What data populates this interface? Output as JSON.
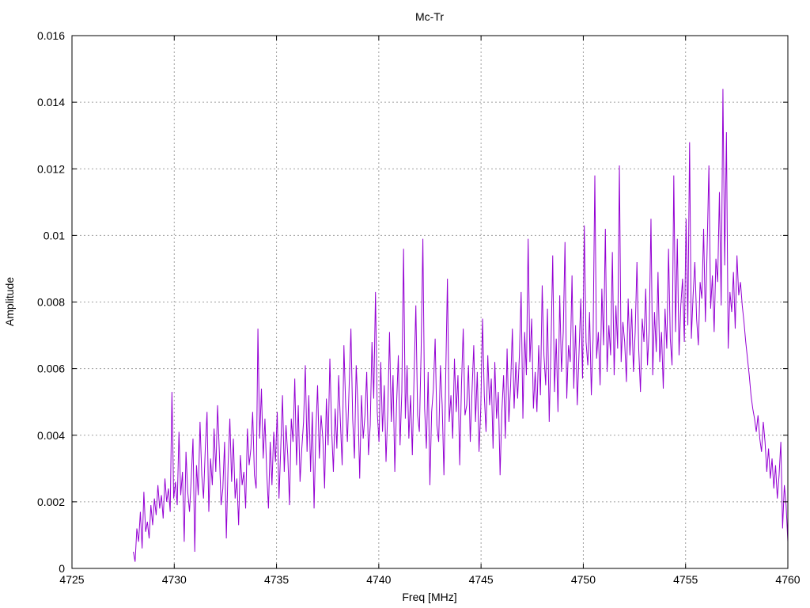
{
  "chart_data": {
    "type": "line",
    "title": "Mc-Tr",
    "xlabel": "Freq [MHz]",
    "ylabel": "Amplitude",
    "xlim": [
      4725,
      4760
    ],
    "ylim": [
      0,
      0.016
    ],
    "x_ticks": [
      "4725",
      "4730",
      "4735",
      "4740",
      "4745",
      "4750",
      "4755",
      "4760"
    ],
    "y_ticks": [
      "0",
      "0.002",
      "0.004",
      "0.006",
      "0.008",
      "0.01",
      "0.012",
      "0.014",
      "0.016"
    ],
    "grid": true,
    "line_color": "#9400d3",
    "series": [
      {
        "x_start": 4728.0,
        "x_end": 4760.0,
        "x_step": 0.04,
        "values": [
          0.0005,
          0.0002,
          0.0012,
          0.0008,
          0.0017,
          0.0006,
          0.0023,
          0.0011,
          0.0014,
          0.0009,
          0.0019,
          0.0013,
          0.0021,
          0.0016,
          0.0025,
          0.0018,
          0.0022,
          0.0015,
          0.0027,
          0.002,
          0.0024,
          0.0017,
          0.0053,
          0.0021,
          0.0026,
          0.0019,
          0.0041,
          0.0022,
          0.0029,
          0.0008,
          0.0035,
          0.0023,
          0.0017,
          0.0027,
          0.0039,
          0.0005,
          0.0031,
          0.0022,
          0.0044,
          0.0028,
          0.0021,
          0.0036,
          0.0047,
          0.0017,
          0.0033,
          0.0025,
          0.0042,
          0.0029,
          0.0049,
          0.0035,
          0.0019,
          0.0024,
          0.0038,
          0.0009,
          0.0031,
          0.0045,
          0.0026,
          0.0039,
          0.0021,
          0.0027,
          0.0013,
          0.0034,
          0.0025,
          0.0029,
          0.0018,
          0.0042,
          0.0031,
          0.0036,
          0.0047,
          0.0028,
          0.0024,
          0.0072,
          0.0039,
          0.0054,
          0.0033,
          0.0045,
          0.0029,
          0.0018,
          0.0038,
          0.0025,
          0.0041,
          0.0032,
          0.0047,
          0.0021,
          0.0036,
          0.0052,
          0.0029,
          0.0043,
          0.0034,
          0.0019,
          0.0045,
          0.0038,
          0.0057,
          0.0031,
          0.0049,
          0.0026,
          0.0036,
          0.0044,
          0.0061,
          0.0035,
          0.0052,
          0.0029,
          0.0047,
          0.0018,
          0.0041,
          0.0055,
          0.0033,
          0.0046,
          0.0039,
          0.0024,
          0.0051,
          0.0037,
          0.0063,
          0.0042,
          0.0029,
          0.0048,
          0.0036,
          0.0058,
          0.0044,
          0.0031,
          0.0067,
          0.0049,
          0.0038,
          0.0055,
          0.0072,
          0.0045,
          0.0033,
          0.0061,
          0.0049,
          0.0027,
          0.0052,
          0.0039,
          0.0046,
          0.0059,
          0.0034,
          0.0043,
          0.0068,
          0.0051,
          0.0083,
          0.0047,
          0.0038,
          0.0062,
          0.0041,
          0.0055,
          0.0032,
          0.0047,
          0.0071,
          0.0044,
          0.0058,
          0.0029,
          0.0049,
          0.0064,
          0.0037,
          0.0053,
          0.0096,
          0.0045,
          0.0061,
          0.0039,
          0.0052,
          0.0034,
          0.0058,
          0.0079,
          0.0046,
          0.0041,
          0.0065,
          0.0099,
          0.0048,
          0.0036,
          0.0059,
          0.0025,
          0.0047,
          0.0054,
          0.0069,
          0.0043,
          0.0038,
          0.0061,
          0.0049,
          0.0028,
          0.0057,
          0.0087,
          0.0044,
          0.0052,
          0.0039,
          0.0063,
          0.0047,
          0.0058,
          0.0031,
          0.0055,
          0.0072,
          0.0046,
          0.0049,
          0.0061,
          0.0038,
          0.0053,
          0.0067,
          0.0044,
          0.0059,
          0.0035,
          0.0048,
          0.0075,
          0.0052,
          0.0041,
          0.0064,
          0.0049,
          0.0057,
          0.0036,
          0.0062,
          0.0045,
          0.0053,
          0.0028,
          0.0047,
          0.0058,
          0.0039,
          0.0066,
          0.0044,
          0.0055,
          0.0072,
          0.0048,
          0.0062,
          0.0051,
          0.0064,
          0.0083,
          0.0045,
          0.0071,
          0.0058,
          0.0099,
          0.0062,
          0.0075,
          0.0048,
          0.0059,
          0.0047,
          0.0067,
          0.0052,
          0.0085,
          0.0064,
          0.0055,
          0.0078,
          0.0044,
          0.0066,
          0.0094,
          0.0053,
          0.0069,
          0.0047,
          0.0082,
          0.0059,
          0.0071,
          0.0098,
          0.0051,
          0.0067,
          0.0062,
          0.0088,
          0.0054,
          0.0073,
          0.0049,
          0.0065,
          0.0081,
          0.0057,
          0.0103,
          0.0068,
          0.0061,
          0.0077,
          0.0052,
          0.0069,
          0.0118,
          0.0063,
          0.0071,
          0.0055,
          0.0084,
          0.0067,
          0.0102,
          0.0059,
          0.0073,
          0.0064,
          0.0095,
          0.0058,
          0.0079,
          0.0066,
          0.0121,
          0.0062,
          0.0074,
          0.0068,
          0.0056,
          0.0081,
          0.0064,
          0.0078,
          0.0059,
          0.0071,
          0.0092,
          0.0066,
          0.0053,
          0.0075,
          0.0068,
          0.0084,
          0.0061,
          0.0072,
          0.0105,
          0.0058,
          0.0077,
          0.0065,
          0.0089,
          0.0062,
          0.0071,
          0.0054,
          0.0078,
          0.0066,
          0.0096,
          0.0069,
          0.0061,
          0.0118,
          0.0071,
          0.0099,
          0.0064,
          0.0079,
          0.0087,
          0.0068,
          0.0105,
          0.0073,
          0.0128,
          0.0069,
          0.0082,
          0.0092,
          0.0075,
          0.0067,
          0.0086,
          0.0081,
          0.0102,
          0.0074,
          0.0096,
          0.0121,
          0.0078,
          0.0088,
          0.0071,
          0.0093,
          0.0086,
          0.0113,
          0.0079,
          0.0144,
          0.0091,
          0.0131,
          0.0066,
          0.0083,
          0.0077,
          0.0089,
          0.0072,
          0.0094,
          0.0082,
          0.0086,
          0.0079,
          0.0074,
          0.0068,
          0.0063,
          0.0058,
          0.0052,
          0.0048,
          0.0045,
          0.0041,
          0.0046,
          0.0039,
          0.0035,
          0.0044,
          0.0038,
          0.0029,
          0.0036,
          0.0027,
          0.0033,
          0.0024,
          0.0031,
          0.0021,
          0.0028,
          0.0038,
          0.0012,
          0.0025,
          0.0019,
          0.0008
        ]
      }
    ]
  }
}
